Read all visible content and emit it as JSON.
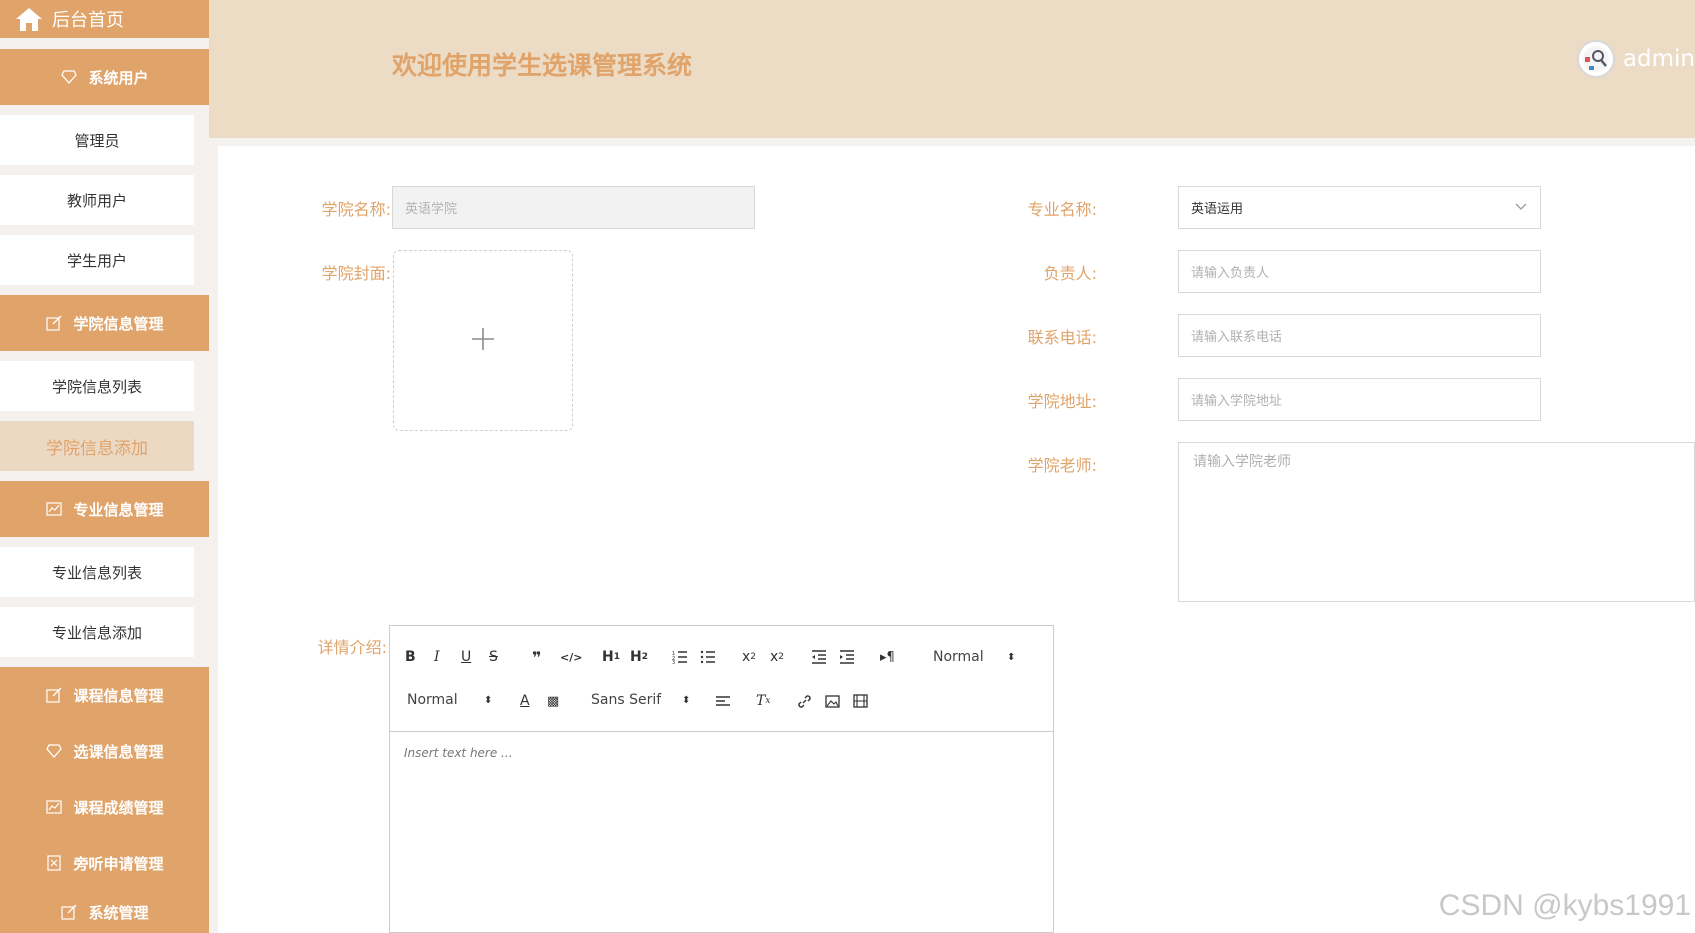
{
  "sidebar": {
    "home_label": "后台首页",
    "groups": [
      {
        "label": "系统用户",
        "icon": "diamond-icon"
      },
      {
        "label": "学院信息管理",
        "icon": "edit-icon"
      },
      {
        "label": "专业信息管理",
        "icon": "chart-icon"
      },
      {
        "label": "课程信息管理",
        "icon": "edit-icon"
      },
      {
        "label": "选课信息管理",
        "icon": "diamond-icon"
      },
      {
        "label": "课程成绩管理",
        "icon": "chart-icon"
      },
      {
        "label": "旁听申请管理",
        "icon": "close-box-icon"
      },
      {
        "label": "系统管理",
        "icon": "edit-icon"
      }
    ],
    "subs": [
      {
        "label": "管理员"
      },
      {
        "label": "教师用户"
      },
      {
        "label": "学生用户"
      },
      {
        "label": "学院信息列表"
      },
      {
        "label": "学院信息添加"
      },
      {
        "label": "专业信息列表"
      },
      {
        "label": "专业信息添加"
      }
    ]
  },
  "header": {
    "welcome": "欢迎使用学生选课管理系统",
    "username": "admin"
  },
  "form": {
    "college_name_label": "学院名称:",
    "college_name_value": "英语学院",
    "cover_label": "学院封面:",
    "major_label": "专业名称:",
    "major_value": "英语运用",
    "owner_label": "负责人:",
    "owner_placeholder": "请输入负责人",
    "phone_label": "联系电话:",
    "phone_placeholder": "请输入联系电话",
    "address_label": "学院地址:",
    "address_placeholder": "请输入学院地址",
    "teacher_label": "学院老师:",
    "teacher_placeholder": "请输入学院老师",
    "detail_label": "详情介绍:"
  },
  "editor": {
    "header_select": "Normal",
    "size_select": "Normal",
    "font_select": "Sans Serif",
    "placeholder": "Insert text here ..."
  },
  "watermark": "CSDN @kybs1991",
  "colors": {
    "accent": "#e0a36a",
    "header_bg": "#ecdcc6"
  }
}
